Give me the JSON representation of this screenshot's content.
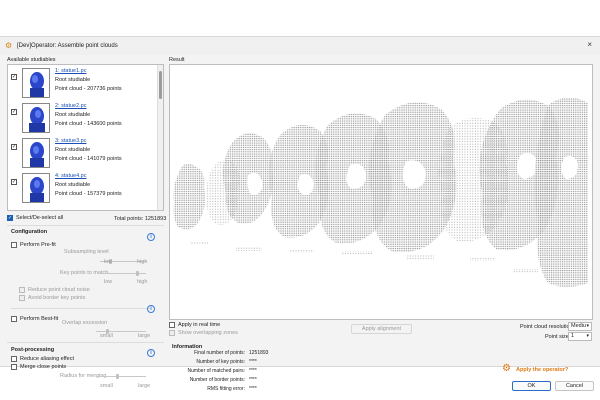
{
  "window": {
    "title": "[Dev]Operator: Assemble point clouds",
    "close_glyph": "×",
    "accent": "#1a5fb4"
  },
  "left": {
    "available_label": "Available studiables",
    "items": [
      {
        "name": "1: statue1.pc",
        "type": "Root studiable",
        "points": "Point cloud - 207736 points",
        "checked": true
      },
      {
        "name": "2: statue2.pc",
        "type": "Root studiable",
        "points": "Point cloud - 143600 points",
        "checked": true
      },
      {
        "name": "3: statue3.pc",
        "type": "Root studiable",
        "points": "Point cloud - 141079 points",
        "checked": true
      },
      {
        "name": "4: statue4.pc",
        "type": "Root studiable",
        "points": "Point cloud - 157379 points",
        "checked": true
      }
    ],
    "select_all_label": "Select/De-select all",
    "total_points_label": "Total points: 1251893",
    "configuration": {
      "title": "Configuration",
      "perform_prefit": "Perform Pre-fit",
      "subsampling_level": "Subsampling level",
      "low": "low",
      "high": "high",
      "key_points_to_match": "Key points to match",
      "reduce_noise": "Reduce point cloud noise",
      "avoid_border": "Avoid border key points",
      "perform_bestfit": "Perform Best-fit",
      "overlap_label": "Overlap excession",
      "small": "small",
      "large": "large"
    },
    "post_processing": {
      "title": "Post-processing",
      "reduce_aliasing": "Reduce aliasing effect",
      "merge_close": "Merge close points",
      "radius_label": "Radius for merging",
      "small": "small",
      "large": "large"
    }
  },
  "result": {
    "label": "Result",
    "apply_realtime": "Apply in real time",
    "show_overlapping": "Show overlapping zones",
    "apply_alignment": "Apply alignment",
    "resolution_label": "Point cloud resolution:",
    "resolution_value": "Mediu",
    "point_size_label": "Point size:",
    "point_size_value": "1"
  },
  "information": {
    "title": "Information",
    "rows": [
      {
        "k": "Final number of points:",
        "v": "1251893"
      },
      {
        "k": "Number of key points:",
        "v": "****"
      },
      {
        "k": "Number of matched pairs:",
        "v": "****"
      },
      {
        "k": "Number of border points:",
        "v": "****"
      },
      {
        "k": "RMS fitting error:",
        "v": "****"
      }
    ]
  },
  "footer": {
    "apply_operator": "Apply the operator?",
    "ok": "OK",
    "cancel": "Cancel"
  },
  "icons": {
    "app": "gear-icon",
    "info": "info-icon",
    "apply": "gears-icon"
  }
}
